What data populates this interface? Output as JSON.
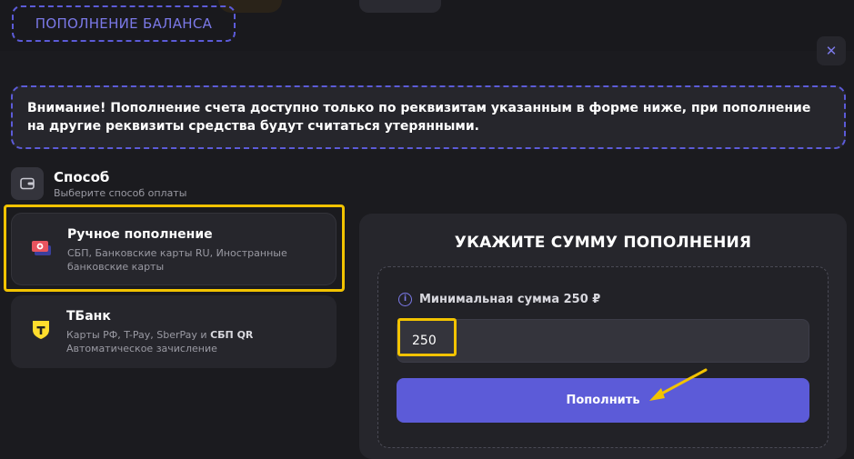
{
  "header": {
    "title": "ПОПОЛНЕНИЕ БАЛАНСА",
    "close_symbol": "✕"
  },
  "warning": {
    "text": "Внимание! Пополнение счета доступно только по реквизитам указанным в форме ниже, при пополнение на другие реквизиты средства будут считаться утерянными."
  },
  "method": {
    "title": "Способ",
    "subtitle": "Выберите способ оплаты"
  },
  "payment_methods": [
    {
      "title": "Ручное пополнение",
      "description": "СБП, Банковские карты RU, Иностранные банковские карты",
      "icon": "card-stack-icon",
      "selected": true
    },
    {
      "title": "ТБанк",
      "description_prefix": "Карты РФ, T-Pay, SberPay и",
      "description_bold": "СБП QR",
      "description_line2": "Автоматическое зачисление",
      "icon": "tbank-logo-icon"
    }
  ],
  "amount": {
    "title": "УКАЖИТЕ СУММУ ПОПОЛНЕНИЯ",
    "min_label": "Минимальная сумма 250 ₽",
    "value": "250",
    "button_label": "Пополнить"
  },
  "colors": {
    "accent": "#5c5bd8",
    "highlight": "#f2c300",
    "background": "#1b1b1f",
    "card": "#26262c"
  }
}
